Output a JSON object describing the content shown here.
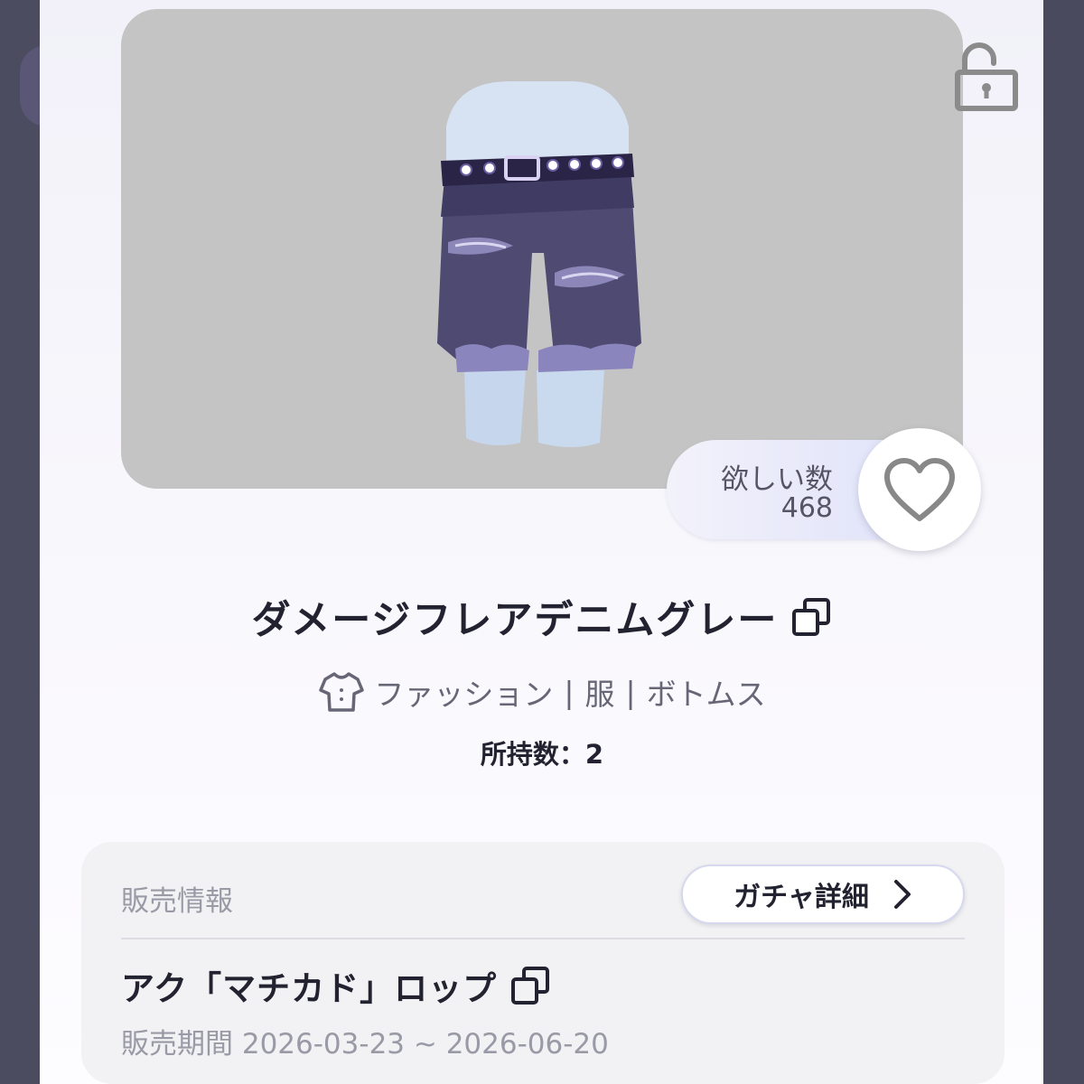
{
  "item": {
    "name": "ダメージフレアデニムグレー",
    "category": {
      "parts": [
        "ファッション",
        "服",
        "ボトムス"
      ],
      "separator": "|"
    },
    "owned": "所持数：2"
  },
  "wishlist": {
    "label": "欲しい数",
    "count": "468"
  },
  "sales": {
    "title": "販売情報",
    "gacha_button_label": "ガチャ詳細",
    "shop_name": "アク「マチカド」ロップ",
    "period": "販売期間 2026-03-23 ~ 2026-06-20"
  },
  "icons": {
    "lock": "unlocked-padlock-icon",
    "heart": "heart-outline-icon",
    "copy": "copy-icon",
    "category": "shirt-icon",
    "chevron": "chevron-right-icon"
  },
  "colors": {
    "preview_bg": "#c4c4c4",
    "denim": "#4e4a72",
    "text_primary": "#222230",
    "text_muted": "#999aa6"
  }
}
